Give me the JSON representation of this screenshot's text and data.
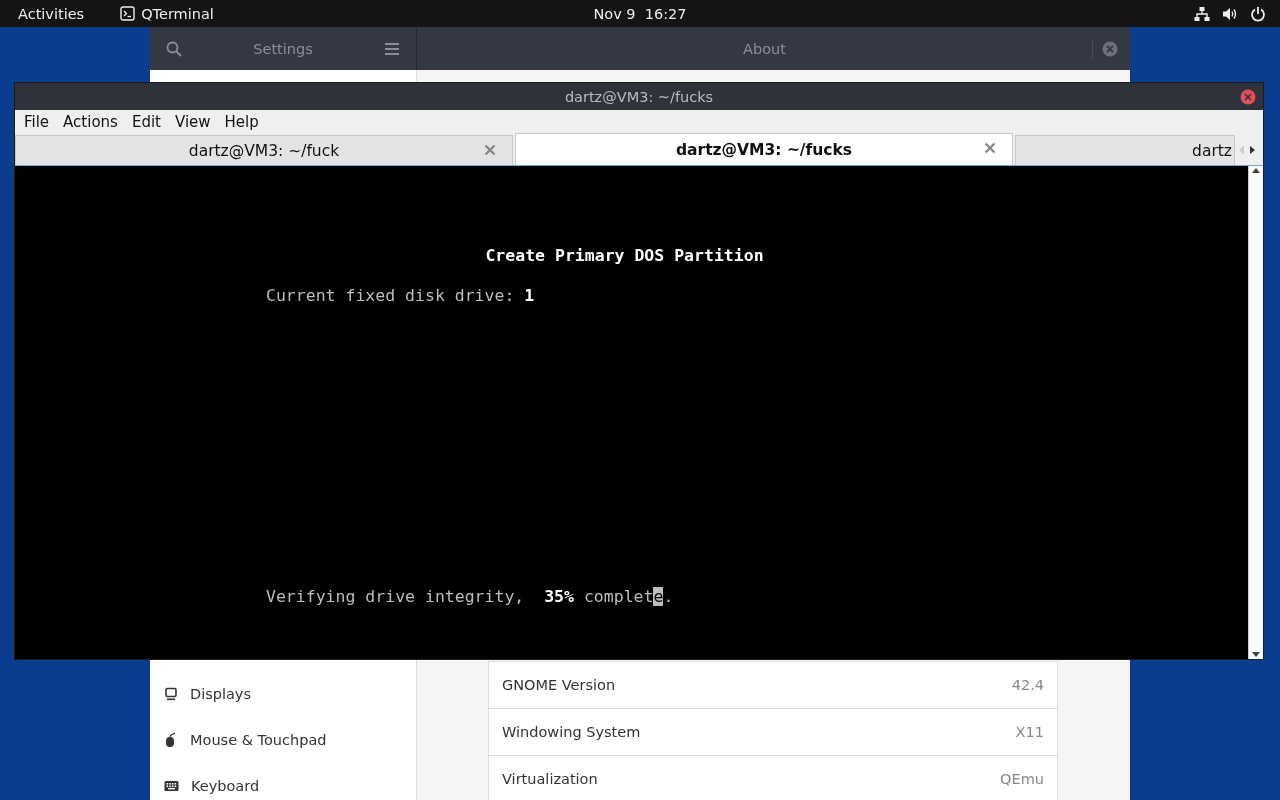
{
  "top_bar": {
    "activities": "Activities",
    "app": "QTerminal",
    "clock": "Nov 9  16:27"
  },
  "settings_window": {
    "sidebar_title": "Settings",
    "page_title": "About",
    "sidebar": {
      "items": [
        {
          "label": "Displays",
          "kind": "display"
        },
        {
          "label": "Mouse & Touchpad",
          "kind": "mouse"
        },
        {
          "label": "Keyboard",
          "kind": "keyboard"
        }
      ]
    },
    "info_rows": [
      {
        "label": "GNOME Version",
        "value": "42.4"
      },
      {
        "label": "Windowing System",
        "value": "X11"
      },
      {
        "label": "Virtualization",
        "value": "QEmu"
      }
    ]
  },
  "terminal_window": {
    "title": "dartz@VM3: ~/fucks",
    "menu": [
      "File",
      "Actions",
      "Edit",
      "View",
      "Help"
    ],
    "tabs": [
      {
        "label": "dartz@VM3: ~/fuck",
        "selected": false,
        "closable": true
      },
      {
        "label": "dartz@VM3: ~/fucks",
        "selected": true,
        "closable": true
      },
      {
        "label": "dartz",
        "selected": false,
        "closable": false
      }
    ],
    "screen": {
      "lines": [
        {
          "kind": "heading",
          "text": "Create Primary DOS Partition"
        },
        {
          "kind": "field",
          "text": "Current fixed disk drive: **1**"
        },
        {
          "kind": "status",
          "text": "Verifying drive integrity,  **35%** complet",
          "cursor": "e",
          "after": "."
        }
      ]
    }
  }
}
